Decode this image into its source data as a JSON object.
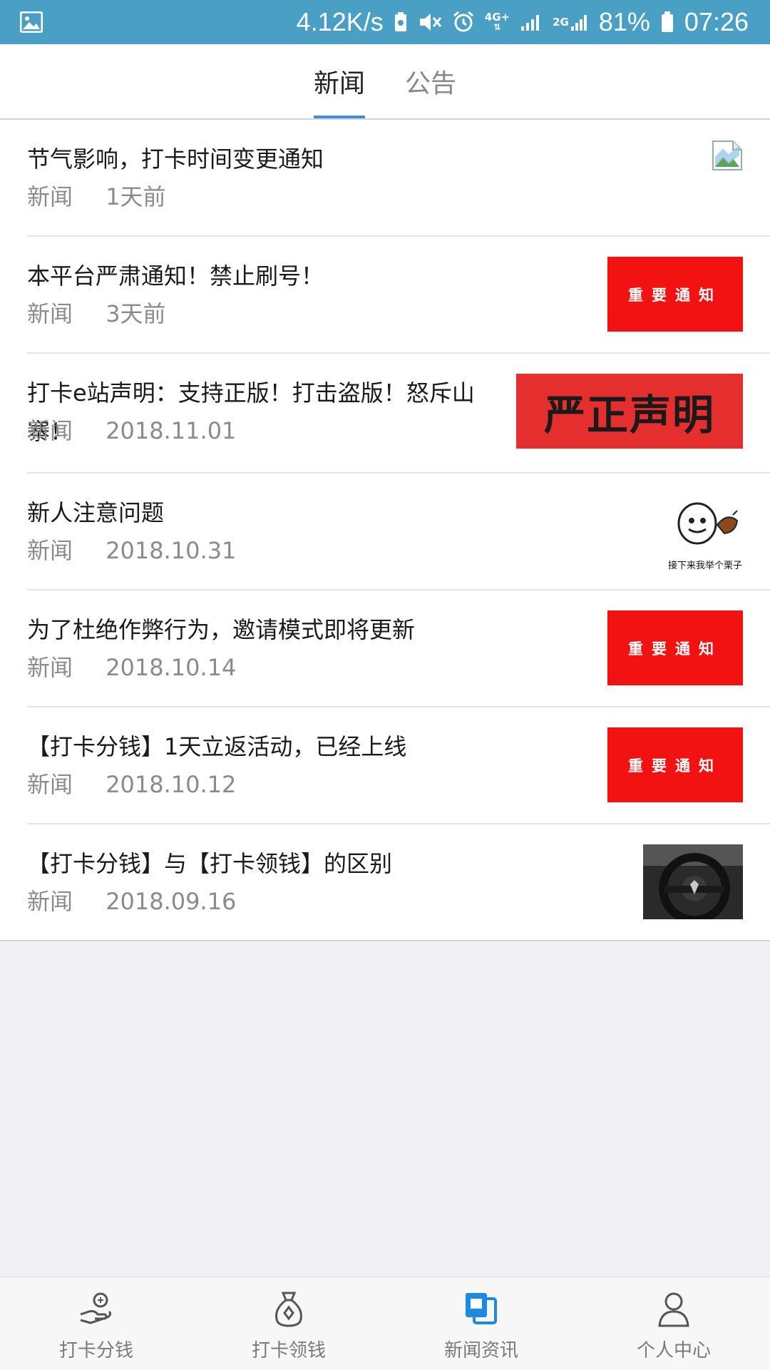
{
  "status_bar": {
    "net_speed": "4.12K/s",
    "network_label": "4G+",
    "network2_label": "2G",
    "battery": "81%",
    "time": "07:26"
  },
  "tabs": [
    {
      "label": "新闻",
      "active": true
    },
    {
      "label": "公告",
      "active": false
    }
  ],
  "news": [
    {
      "title": "节气影响，打卡时间变更通知",
      "tag": "新闻",
      "time": "1天前",
      "thumb": "broken-image-icon"
    },
    {
      "title": "本平台严肃通知！禁止刷号！",
      "tag": "新闻",
      "time": "3天前",
      "thumb": "important-notice",
      "thumb_text": "重要通知"
    },
    {
      "title": "打卡e站声明：支持正版！打击盗版！怒斥山寨！",
      "tag": "新闻",
      "time": "2018.11.01",
      "thumb": "declaration",
      "thumb_text": "严正声明"
    },
    {
      "title": "新人注意问题",
      "tag": "新闻",
      "time": "2018.10.31",
      "thumb": "meme",
      "thumb_text": "接下来我举个栗子"
    },
    {
      "title": "为了杜绝作弊行为，邀请模式即将更新",
      "tag": "新闻",
      "time": "2018.10.14",
      "thumb": "important-notice",
      "thumb_text": "重要通知"
    },
    {
      "title": "【打卡分钱】1天立返活动，已经上线",
      "tag": "新闻",
      "time": "2018.10.12",
      "thumb": "important-notice",
      "thumb_text": "重要通知"
    },
    {
      "title": "【打卡分钱】与【打卡领钱】的区别",
      "tag": "新闻",
      "time": "2018.09.16",
      "thumb": "steering-wheel-photo"
    }
  ],
  "bottom_nav": [
    {
      "label": "打卡分钱",
      "icon": "coin-hand-icon",
      "active": false
    },
    {
      "label": "打卡领钱",
      "icon": "money-bag-icon",
      "active": false
    },
    {
      "label": "新闻资讯",
      "icon": "news-icon",
      "active": true
    },
    {
      "label": "个人中心",
      "icon": "person-icon",
      "active": false
    }
  ],
  "colors": {
    "status_bar": "#4a9fc4",
    "tab_indicator": "#3f8fd2",
    "notice_red": "#f21212",
    "nav_active": "#1e88e5"
  }
}
